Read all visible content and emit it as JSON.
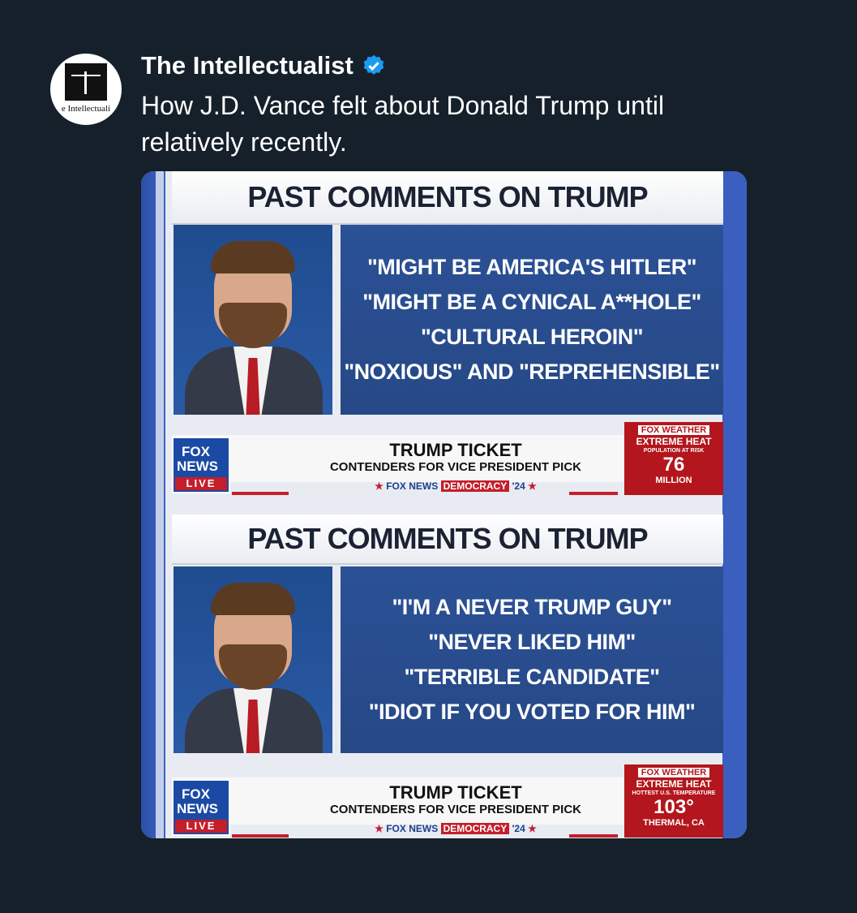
{
  "post": {
    "author": "The Intellectualist",
    "avatar_text": "e Intellectuali",
    "text": "How J.D. Vance felt about Donald Trump until relatively recently."
  },
  "frames": [
    {
      "title": "PAST COMMENTS ON TRUMP",
      "quotes": [
        "\"MIGHT BE AMERICA'S HITLER\"",
        "\"MIGHT BE A CYNICAL A**HOLE\"",
        "\"CULTURAL HEROIN\"",
        "\"NOXIOUS\" AND \"REPREHENSIBLE\""
      ],
      "fox_logo": [
        "FOX",
        "NEWS",
        "LIVE"
      ],
      "headline": "TRUMP TICKET",
      "subhead": "CONTENDERS FOR VICE PRESIDENT PICK",
      "brand_left": "FOX NEWS",
      "brand_mid": "DEMOCRACY",
      "brand_right": "'24",
      "weather": [
        "FOX WEATHER",
        "EXTREME HEAT",
        "POPULATION AT RISK",
        "76",
        "MILLION"
      ]
    },
    {
      "title": "PAST COMMENTS ON TRUMP",
      "quotes": [
        "\"I'M A NEVER TRUMP GUY\"",
        "\"NEVER LIKED HIM\"",
        "\"TERRIBLE CANDIDATE\"",
        "\"IDIOT IF YOU VOTED FOR HIM\""
      ],
      "fox_logo": [
        "FOX",
        "NEWS",
        "LIVE"
      ],
      "headline": "TRUMP TICKET",
      "subhead": "CONTENDERS FOR VICE PRESIDENT PICK",
      "brand_left": "FOX NEWS",
      "brand_mid": "DEMOCRACY",
      "brand_right": "'24",
      "weather": [
        "FOX WEATHER",
        "EXTREME HEAT",
        "HOTTEST U.S. TEMPERATURE",
        "103°",
        "THERMAL, CA"
      ]
    }
  ],
  "colors": {
    "background": "#15202b",
    "verified": "#1d9bf0",
    "fox_blue": "#1b4aa5",
    "fox_red": "#c41e2a"
  },
  "icons": {
    "verified": "verified-badge-icon"
  }
}
